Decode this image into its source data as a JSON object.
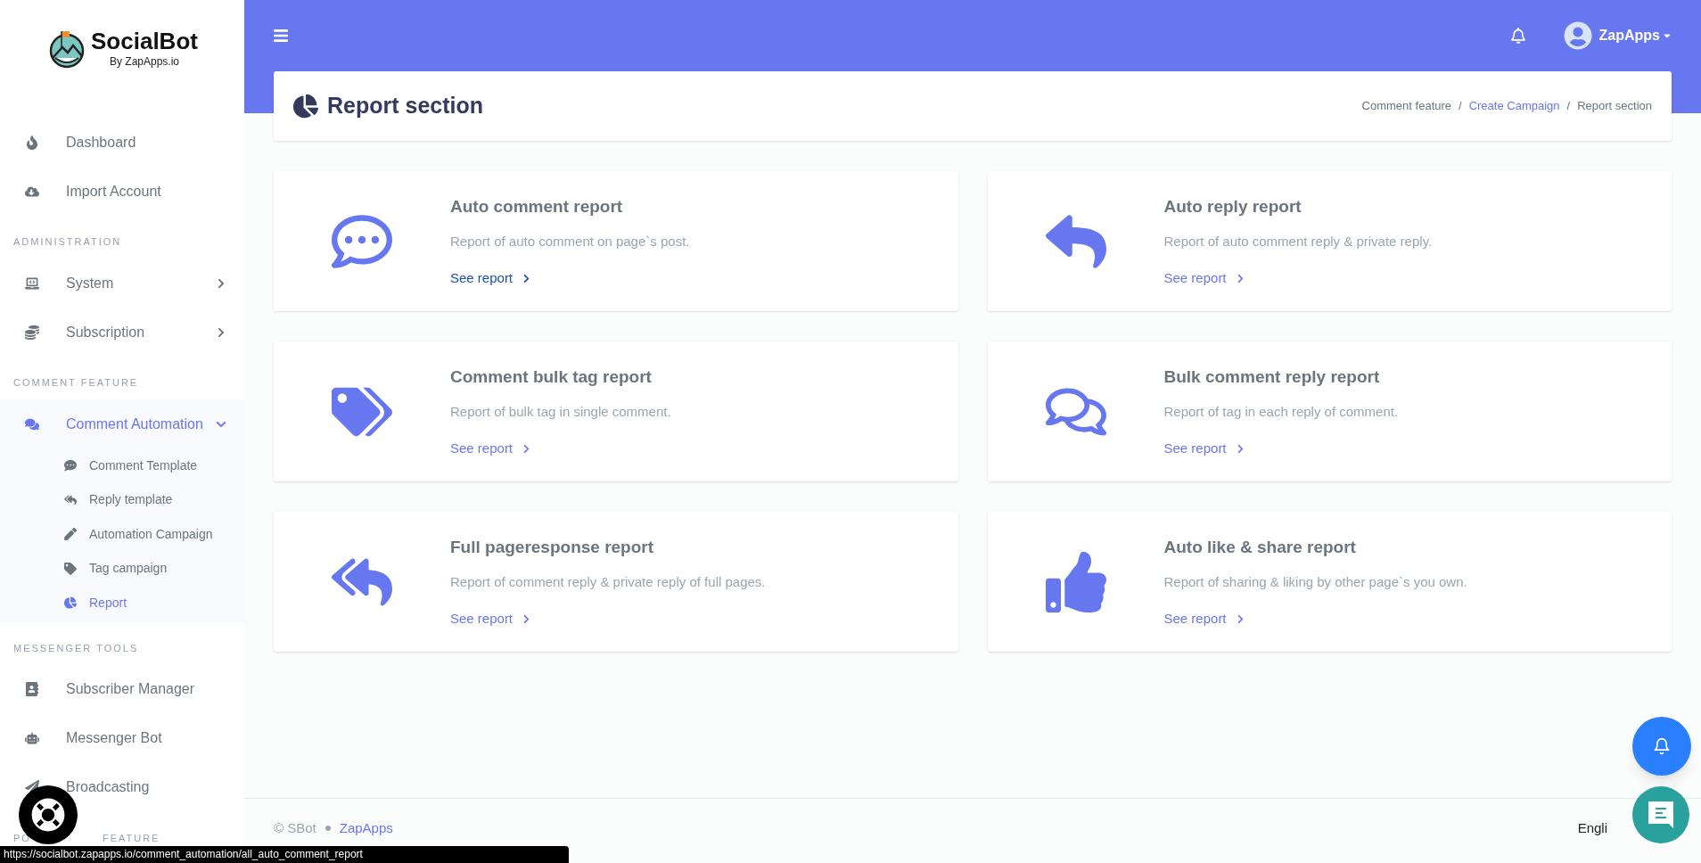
{
  "logo": {
    "name": "SocialBot",
    "tagline": "By ZapApps.io"
  },
  "sidebar": {
    "sections": [
      {
        "items": [
          {
            "label": "Dashboard",
            "selected": false
          },
          {
            "label": "Import Account",
            "selected": false
          }
        ]
      },
      {
        "heading": [
          "ADMINISTRATION"
        ],
        "items": [
          {
            "label": "System",
            "selected": false,
            "expanded": false
          },
          {
            "label": "Subscription",
            "selected": false,
            "expanded": false
          }
        ]
      },
      {
        "heading": [
          "COMMENT FEATURE"
        ],
        "items": [
          {
            "label": "Comment Automation",
            "selected": true,
            "expanded": true,
            "children": [
              {
                "label": "Comment Template",
                "selected": false
              },
              {
                "label": "Reply template",
                "selected": false
              },
              {
                "label": "Automation Campaign",
                "selected": false
              },
              {
                "label": "Tag campaign",
                "selected": false
              },
              {
                "label": "Report",
                "selected": true
              }
            ]
          }
        ]
      },
      {
        "heading": [
          "MESSENGER TOOLS"
        ],
        "items": [
          {
            "label": "Subscriber Manager",
            "selected": false
          },
          {
            "label": "Messenger Bot",
            "selected": false
          },
          {
            "label": "Broadcasting",
            "selected": false
          }
        ]
      },
      {
        "heading": [
          "PO",
          "FEATURE"
        ]
      }
    ]
  },
  "topbar": {
    "user": "ZapApps"
  },
  "page": {
    "title": "Report section",
    "breadcrumb_separator": "/",
    "breadcrumb": [
      {
        "label": "Comment feature",
        "link": false
      },
      {
        "label": "Create Campaign",
        "link": true
      },
      {
        "label": "Report section",
        "link": false
      }
    ]
  },
  "cards": [
    {
      "title": "Auto comment report",
      "description": "Report of auto comment on page`s post.",
      "link": "See report",
      "hovered": true
    },
    {
      "title": "Auto reply report",
      "description": "Report of auto comment reply & private reply.",
      "link": "See report",
      "hovered": false
    },
    {
      "title": "Comment bulk tag report",
      "description": "Report of bulk tag in single comment.",
      "link": "See report",
      "hovered": false
    },
    {
      "title": "Bulk comment reply report",
      "description": "Report of tag in each reply of comment.",
      "link": "See report",
      "hovered": false
    },
    {
      "title": "Full pageresponse report",
      "description": "Report of comment reply & private reply of full pages.",
      "link": "See report",
      "hovered": false
    },
    {
      "title": "Auto like & share report",
      "description": "Report of sharing & liking by other page`s you own.",
      "link": "See report",
      "hovered": false
    }
  ],
  "footer": {
    "copyright": "© SBot",
    "link": "ZapApps",
    "language": "Engli"
  },
  "status_bar": "https://socialbot.zapapps.io/comment_automation/all_auto_comment_report"
}
